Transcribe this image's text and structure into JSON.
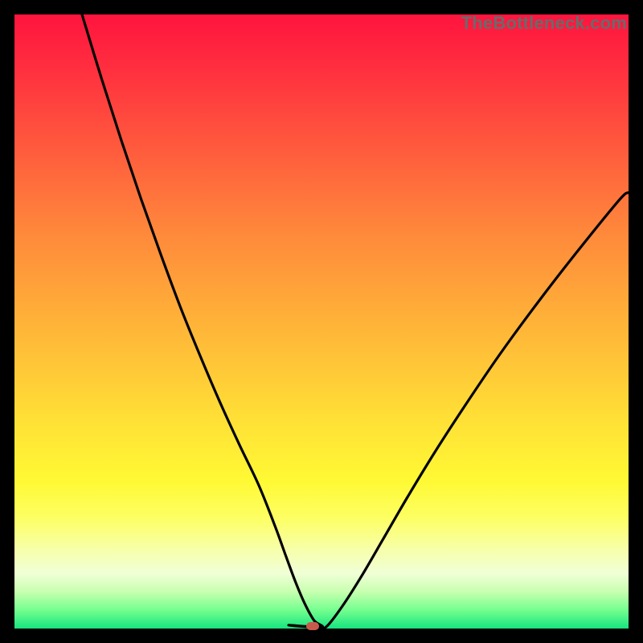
{
  "watermark": "TheBottleneck.com",
  "marker": {
    "cx_pct": 48.5,
    "cy_pct": 99.6
  },
  "colors": {
    "curve_stroke": "#000000",
    "marker_fill": "#c85a4d"
  },
  "chart_data": {
    "type": "line",
    "title": "",
    "xlabel": "",
    "ylabel": "",
    "xlim": [
      0,
      100
    ],
    "ylim": [
      0,
      100
    ],
    "note": "Two smooth black curves descending from top edges to a shared trough near the bottom center; bottleneck-style V shape on a red→yellow→green vertical gradient background.",
    "series": [
      {
        "name": "left-curve",
        "x": [
          11.0,
          14.2,
          17.4,
          20.6,
          23.8,
          27.0,
          30.2,
          33.4,
          36.6,
          39.8,
          42.5,
          44.2,
          45.8,
          47.3,
          48.8,
          50.0
        ],
        "y": [
          100.0,
          89.5,
          79.5,
          70.0,
          61.0,
          52.4,
          44.5,
          37.0,
          30.0,
          23.3,
          16.5,
          11.8,
          7.5,
          4.0,
          1.3,
          0.25
        ]
      },
      {
        "name": "trough",
        "x": [
          44.8,
          46.0,
          47.2,
          48.4,
          49.6,
          50.8
        ],
        "y": [
          0.55,
          0.4,
          0.3,
          0.24,
          0.22,
          0.3
        ]
      },
      {
        "name": "right-curve",
        "x": [
          50.8,
          53.3,
          56.5,
          60.0,
          64.0,
          68.5,
          73.5,
          79.0,
          85.0,
          91.5,
          98.5,
          100.0
        ],
        "y": [
          0.3,
          3.5,
          8.5,
          14.5,
          21.4,
          28.8,
          36.5,
          44.6,
          52.8,
          61.2,
          69.8,
          71.0
        ]
      }
    ]
  }
}
